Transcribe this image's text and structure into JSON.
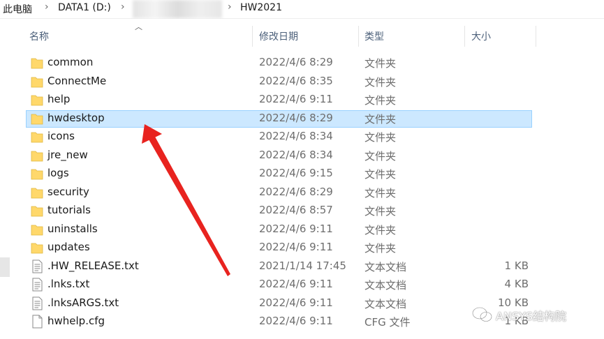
{
  "breadcrumb": {
    "items": [
      "此电脑",
      "DATA1 (D:)",
      "HW2021"
    ],
    "separator": "›"
  },
  "columns": {
    "name": "名称",
    "date": "修改日期",
    "type": "类型",
    "size": "大小"
  },
  "files": [
    {
      "name": "common",
      "date": "2022/4/6 8:29",
      "type": "文件夹",
      "size": "",
      "icon": "folder-icon"
    },
    {
      "name": "ConnectMe",
      "date": "2022/4/6 8:35",
      "type": "文件夹",
      "size": "",
      "icon": "folder-icon"
    },
    {
      "name": "help",
      "date": "2022/4/6 9:11",
      "type": "文件夹",
      "size": "",
      "icon": "folder-icon"
    },
    {
      "name": "hwdesktop",
      "date": "2022/4/6 8:29",
      "type": "文件夹",
      "size": "",
      "icon": "folder-icon",
      "selected": true
    },
    {
      "name": "icons",
      "date": "2022/4/6 8:34",
      "type": "文件夹",
      "size": "",
      "icon": "folder-icon"
    },
    {
      "name": "jre_new",
      "date": "2022/4/6 8:34",
      "type": "文件夹",
      "size": "",
      "icon": "folder-icon"
    },
    {
      "name": "logs",
      "date": "2022/4/6 9:15",
      "type": "文件夹",
      "size": "",
      "icon": "folder-icon"
    },
    {
      "name": "security",
      "date": "2022/4/6 8:29",
      "type": "文件夹",
      "size": "",
      "icon": "folder-icon"
    },
    {
      "name": "tutorials",
      "date": "2022/4/6 8:57",
      "type": "文件夹",
      "size": "",
      "icon": "folder-icon"
    },
    {
      "name": "uninstalls",
      "date": "2022/4/6 9:11",
      "type": "文件夹",
      "size": "",
      "icon": "folder-icon"
    },
    {
      "name": "updates",
      "date": "2022/4/6 9:11",
      "type": "文件夹",
      "size": "",
      "icon": "folder-icon"
    },
    {
      "name": ".HW_RELEASE.txt",
      "date": "2021/1/14 17:45",
      "type": "文本文档",
      "size": "1 KB",
      "icon": "text-file-icon"
    },
    {
      "name": ".lnks.txt",
      "date": "2022/4/6 9:11",
      "type": "文本文档",
      "size": "4 KB",
      "icon": "text-file-icon"
    },
    {
      "name": ".lnksARGS.txt",
      "date": "2022/4/6 9:11",
      "type": "文本文档",
      "size": "10 KB",
      "icon": "text-file-icon"
    },
    {
      "name": "hwhelp.cfg",
      "date": "2022/4/6 9:11",
      "type": "CFG 文件",
      "size": "1 KB",
      "icon": "file-icon"
    }
  ],
  "watermark": {
    "text": "ANSYS结构院"
  },
  "colors": {
    "folder": "#ffd86b",
    "selection": "#cce8ff",
    "selection_border": "#99d1ff",
    "annotation_arrow": "#e8231f"
  }
}
